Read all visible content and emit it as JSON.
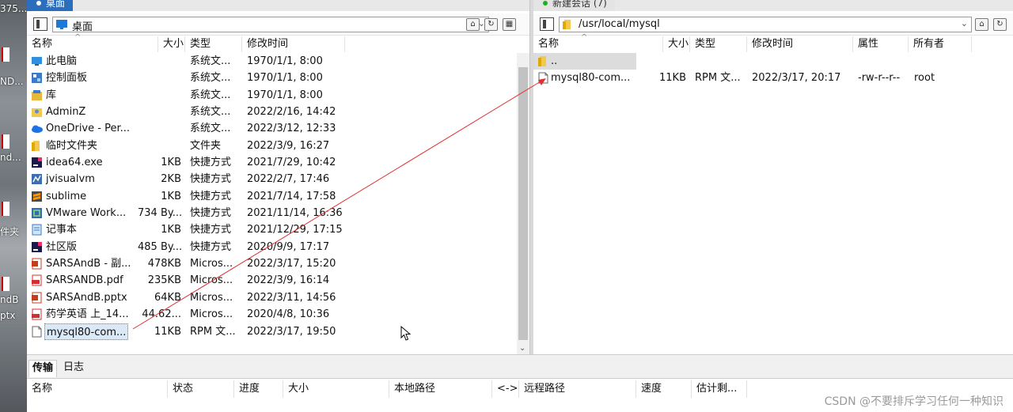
{
  "desktop": {
    "labels": [
      "375...",
      "ND...",
      "nd...",
      "件夹",
      "ndB",
      "ptx"
    ]
  },
  "left": {
    "tab_label": "桌面",
    "path": "桌面",
    "columns": [
      "名称",
      "大小",
      "类型",
      "修改时间"
    ],
    "files": [
      {
        "name": "此电脑",
        "size": "",
        "type": "系统文...",
        "mtime": "1970/1/1, 8:00",
        "icon": "computer-icon"
      },
      {
        "name": "控制面板",
        "size": "",
        "type": "系统文...",
        "mtime": "1970/1/1, 8:00",
        "icon": "control-panel-icon"
      },
      {
        "name": "库",
        "size": "",
        "type": "系统文...",
        "mtime": "1970/1/1, 8:00",
        "icon": "library-icon"
      },
      {
        "name": "AdminZ",
        "size": "",
        "type": "系统文...",
        "mtime": "2022/2/16, 14:42",
        "icon": "user-folder-icon"
      },
      {
        "name": "OneDrive - Per...",
        "size": "",
        "type": "系统文...",
        "mtime": "2022/3/12, 12:33",
        "icon": "cloud-icon"
      },
      {
        "name": "临时文件夹",
        "size": "",
        "type": "文件夹",
        "mtime": "2022/3/9, 16:27",
        "icon": "folder-icon"
      },
      {
        "name": "idea64.exe",
        "size": "1KB",
        "type": "快捷方式",
        "mtime": "2021/7/29, 10:42",
        "icon": "idea-icon"
      },
      {
        "name": "jvisualvm",
        "size": "2KB",
        "type": "快捷方式",
        "mtime": "2022/2/7, 17:46",
        "icon": "jvisualvm-icon"
      },
      {
        "name": "sublime",
        "size": "1KB",
        "type": "快捷方式",
        "mtime": "2021/7/14, 17:58",
        "icon": "sublime-icon"
      },
      {
        "name": "VMware Work...",
        "size": "734 By...",
        "type": "快捷方式",
        "mtime": "2021/11/14, 16:36",
        "icon": "vmware-icon"
      },
      {
        "name": "记事本",
        "size": "1KB",
        "type": "快捷方式",
        "mtime": "2021/12/29, 17:15",
        "icon": "notepad-icon"
      },
      {
        "name": "社区版",
        "size": "485 By...",
        "type": "快捷方式",
        "mtime": "2020/9/9, 17:17",
        "icon": "idea-icon"
      },
      {
        "name": "SARSAndB - 副...",
        "size": "478KB",
        "type": "Micros...",
        "mtime": "2022/3/17, 15:20",
        "icon": "ppt-icon"
      },
      {
        "name": "SARSANDB.pdf",
        "size": "235KB",
        "type": "Micros...",
        "mtime": "2022/3/9, 16:14",
        "icon": "pdf-icon"
      },
      {
        "name": "SARSAndB.pptx",
        "size": "64KB",
        "type": "Micros...",
        "mtime": "2022/3/11, 14:56",
        "icon": "ppt-icon"
      },
      {
        "name": "药学英语 上_14...",
        "size": "44.62...",
        "type": "Micros...",
        "mtime": "2020/4/8, 10:36",
        "icon": "pdf-icon"
      },
      {
        "name": "mysql80-com...",
        "size": "11KB",
        "type": "RPM 文...",
        "mtime": "2022/3/17, 19:50",
        "icon": "file-icon",
        "selected": true
      }
    ]
  },
  "right": {
    "tab_label": "新建会话 (7)",
    "path": "/usr/local/mysql",
    "columns": [
      "名称",
      "大小",
      "类型",
      "修改时间",
      "属性",
      "所有者"
    ],
    "files": [
      {
        "name": "..",
        "size": "",
        "type": "",
        "mtime": "",
        "attr": "",
        "owner": "",
        "icon": "folder-icon",
        "highlight": true
      },
      {
        "name": "mysql80-com...",
        "size": "11KB",
        "type": "RPM 文...",
        "mtime": "2022/3/17, 20:17",
        "attr": "-rw-r--r--",
        "owner": "root",
        "icon": "file-icon"
      }
    ]
  },
  "bottom": {
    "tabs": [
      "传输",
      "日志"
    ],
    "columns": [
      "名称",
      "状态",
      "进度",
      "大小",
      "本地路径",
      "<->",
      "远程路径",
      "速度",
      "估计剩..."
    ],
    "watermark": "CSDN @不要排斥学习任何一种知识"
  },
  "colors": {
    "accent": "#2a6ebd",
    "arrow": "#e03030"
  }
}
